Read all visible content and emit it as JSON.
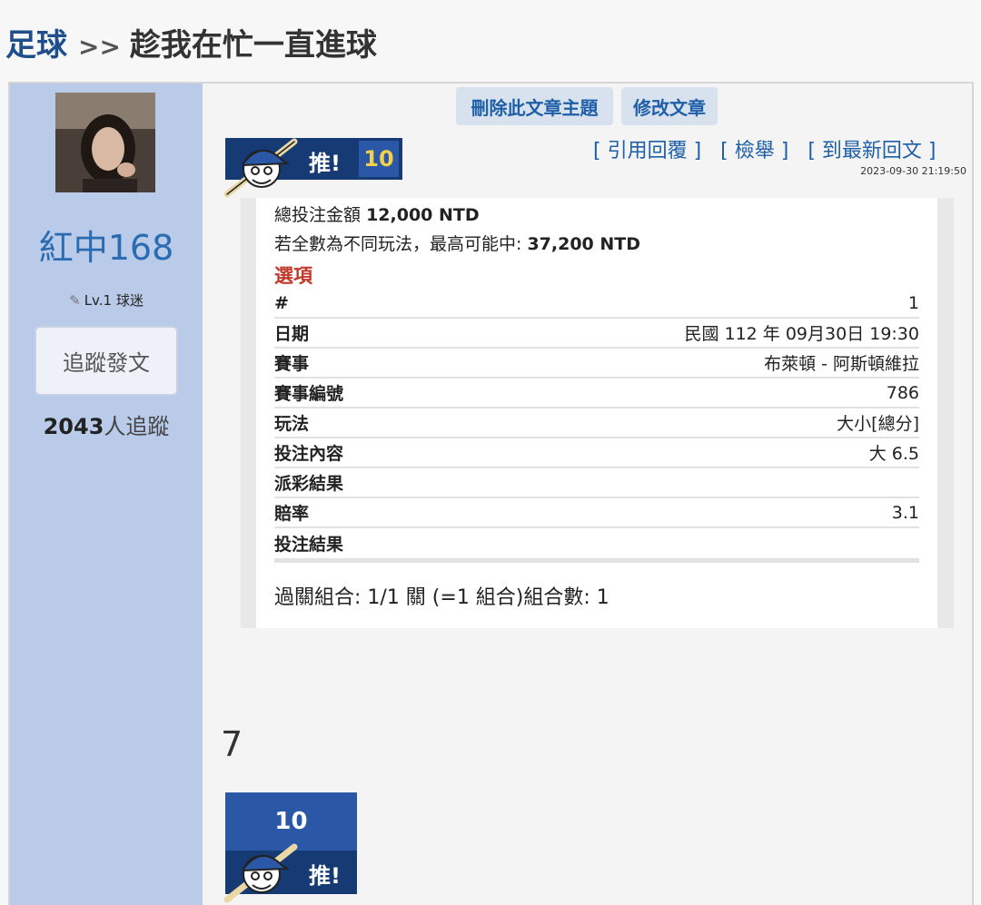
{
  "breadcrumb": {
    "section": "足球",
    "separator": ">>",
    "title": "趁我在忙一直進球"
  },
  "user": {
    "name": "紅中168",
    "level": "Lv.1 球迷",
    "follow_label": "追蹤發文",
    "followers_count": "2043",
    "followers_suffix": "人追蹤"
  },
  "actions": {
    "delete_label": "刪除此文章主題",
    "edit_label": "修改文章"
  },
  "post": {
    "push_label": "推!",
    "push_count": "10",
    "links": [
      "[ 引用回覆 ]",
      "[ 檢舉 ]",
      "[ 到最新回文 ]"
    ],
    "timestamp": "2023-09-30 21:19:50",
    "floor": "7"
  },
  "ticket": {
    "total_label": "總投注金額",
    "total_value": "12,000 NTD",
    "max_label": "若全數為不同玩法，最高可能中:",
    "max_value": "37,200 NTD",
    "options_label": "選項",
    "rows": [
      {
        "k": "#",
        "v": "1"
      },
      {
        "k": "日期",
        "v": "民國 112 年 09月30日 19:30"
      },
      {
        "k": "賽事",
        "v": "布萊頓 - 阿斯頓維拉"
      },
      {
        "k": "賽事編號",
        "v": "786"
      },
      {
        "k": "玩法",
        "v": "大小[總分]"
      },
      {
        "k": "投注內容",
        "v": "大 6.5"
      },
      {
        "k": "派彩結果",
        "v": ""
      },
      {
        "k": "賠率",
        "v": "3.1"
      },
      {
        "k": "投注結果",
        "v": ""
      }
    ],
    "combo": "過關組合: 1/1 關 (=1 組合)組合數: 1"
  },
  "push2": {
    "count": "10",
    "label": "推!"
  },
  "colors": {
    "sidebar": "#b9cbe9",
    "accent": "#1f5fa8",
    "option_red": "#c0392b",
    "push_navy": "#163a73"
  },
  "icons": {
    "pen": "pencil-icon",
    "mascot": "baseball-mascot-icon"
  }
}
